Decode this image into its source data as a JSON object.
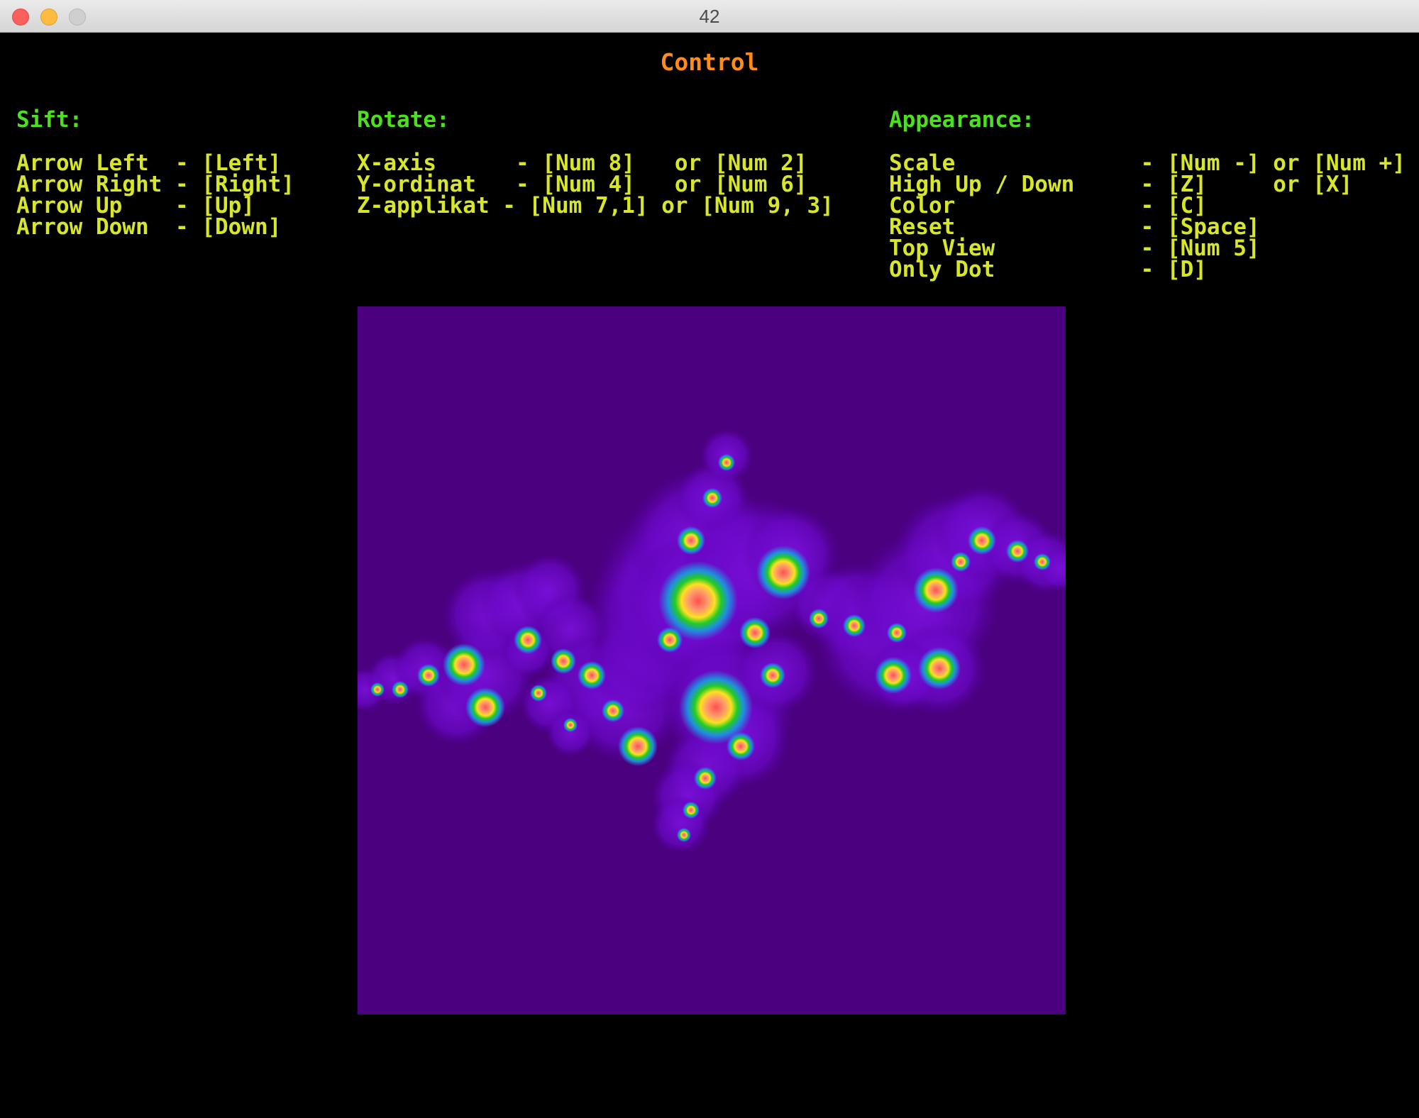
{
  "window": {
    "title": "42"
  },
  "heading": "Control",
  "sections": {
    "shift": {
      "title": "Sift:",
      "lines": [
        "Arrow Left  - [Left]",
        "Arrow Right - [Right]",
        "Arrow Up    - [Up]",
        "Arrow Down  - [Down]"
      ]
    },
    "rotate": {
      "title": "Rotate:",
      "lines": [
        "X-axis      - [Num 8]   or [Num 2]",
        "Y-ordinat   - [Num 4]   or [Num 6]",
        "Z-applikat - [Num 7,1] or [Num 9, 3]"
      ]
    },
    "appearance": {
      "title": "Appearance:",
      "lines": [
        "Scale              - [Num -] or [Num +]",
        "High Up / Down     - [Z]     or [X]",
        "Color              - [C]",
        "Reset              - [Space]",
        "Top View           - [Num 5]",
        "Only Dot           - [D]"
      ]
    }
  },
  "colors": {
    "heading": "#ff8c1a",
    "section_title": "#4de020",
    "keybinding_text": "#d8e62a",
    "fractal_background": "#4b0080",
    "fractal_palette": [
      "#7a10d8",
      "#1f8fe0",
      "#22cc22",
      "#ffe020",
      "#ff9b6b",
      "#ff5050"
    ]
  },
  "fractal": {
    "type": "julia-set"
  }
}
